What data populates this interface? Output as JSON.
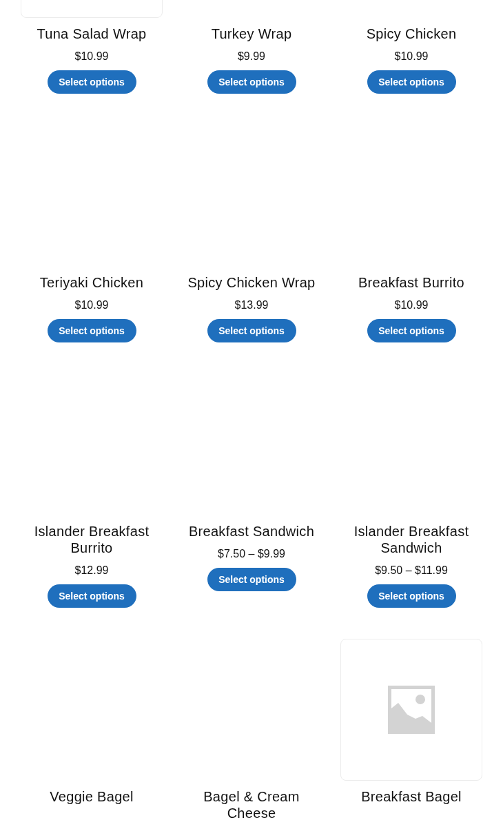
{
  "products": [
    {
      "image": {
        "kind": "frame"
      },
      "title": "Tuna Salad Wrap",
      "price": "$10.99",
      "button": "Select options"
    },
    {
      "title": "Turkey Wrap",
      "price": "$9.99",
      "button": "Select options"
    },
    {
      "title": "Spicy Chicken",
      "price": "$10.99",
      "button": "Select options"
    },
    {
      "title": "Teriyaki Chicken",
      "price": "$10.99",
      "button": "Select options"
    },
    {
      "title": "Spicy Chicken Wrap",
      "price": "$13.99",
      "button": "Select options"
    },
    {
      "title": "Breakfast Burrito",
      "price": "$10.99",
      "button": "Select options"
    },
    {
      "title": "Islander Breakfast Burrito",
      "price": "$12.99",
      "button": "Select options"
    },
    {
      "title": "Breakfast Sandwich",
      "price": "$7.50 – $9.99",
      "button": "Select options"
    },
    {
      "title": "Islander Breakfast Sandwich",
      "price": "$9.50 – $11.99",
      "button": "Select options"
    },
    {
      "title": "Veggie Bagel"
    },
    {
      "title": "Bagel & Cream Cheese"
    },
    {
      "image": {
        "kind": "placeholder"
      },
      "title": "Breakfast Bagel"
    }
  ]
}
